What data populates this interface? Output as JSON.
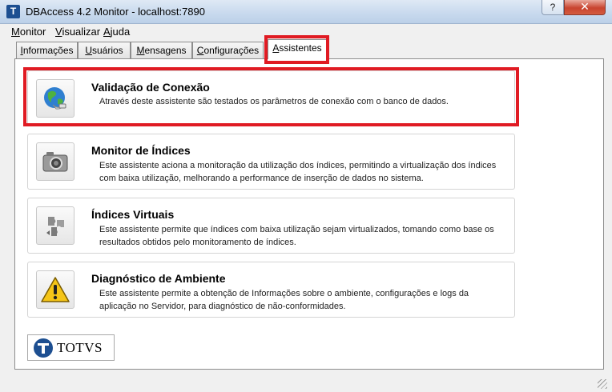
{
  "window": {
    "title": "DBAccess 4.2 Monitor - localhost:7890",
    "app_icon_letter": "T",
    "help_label": "?",
    "close_label": "✕"
  },
  "menu": [
    {
      "label": "Monitor",
      "accel": "M",
      "rest": "onitor"
    },
    {
      "label": "Visualizar",
      "accel": "V",
      "rest": "isualizar"
    },
    {
      "label": "Ajuda",
      "accel": "A",
      "rest": "juda"
    }
  ],
  "tabs": [
    {
      "label": "Informações",
      "accel": "I",
      "rest": "nformações"
    },
    {
      "label": "Usuários",
      "accel": "U",
      "rest": "suários"
    },
    {
      "label": "Mensagens",
      "accel": "M",
      "rest": "ensagens"
    },
    {
      "label": "Configurações",
      "accel": "C",
      "rest": "onfigurações"
    },
    {
      "label": "Assistentes",
      "accel": "A",
      "rest": "ssistentes",
      "active": true
    }
  ],
  "assistants": [
    {
      "icon": "globe-connection-icon",
      "title": "Validação de Conexão",
      "desc": "Através deste assistente são testados os parâmetros de conexão com o banco de dados."
    },
    {
      "icon": "camera-icon",
      "title": "Monitor de Índices",
      "desc": "Este assistente aciona a monitoração da utilização dos índices, permitindo a virtualização dos índices com baixa utilização, melhorando a performance de inserção de dados no sistema."
    },
    {
      "icon": "puzzle-pieces-icon",
      "title": "Índices Virtuais",
      "desc": "Este assistente permite que índices com baixa utilização sejam virtualizados, tomando como base os resultados obtidos pelo monitoramento de índices."
    },
    {
      "icon": "warning-icon",
      "title": "Diagnóstico de Ambiente",
      "desc": "Este assistente permite a obtenção de Informações sobre o ambiente, configurações e logs da aplicação no Servidor, para diagnóstico de não-conformidades."
    }
  ],
  "logo": {
    "text": "TOTVS",
    "colors": {
      "brand": "#1d4f91"
    }
  },
  "colors": {
    "highlight": "#e01b23"
  }
}
